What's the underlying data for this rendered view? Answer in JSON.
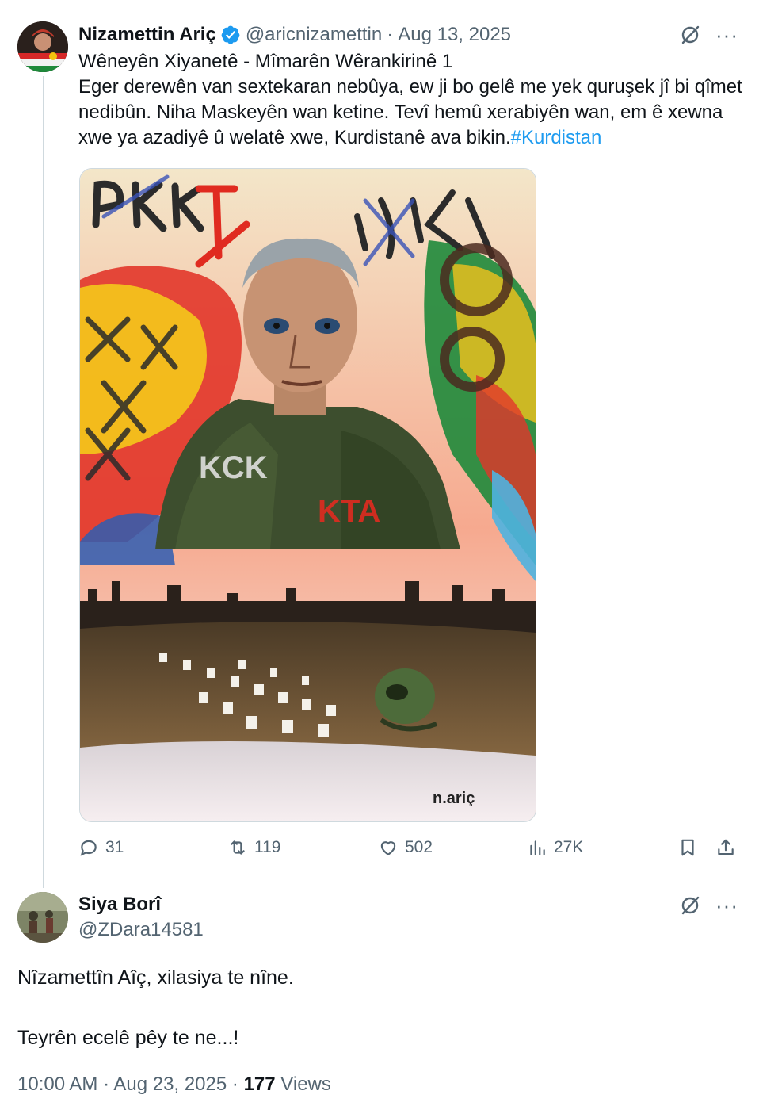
{
  "tweet": {
    "author_name": "Nizamettin Ariç",
    "handle": "@aricnizamettin",
    "separator": "·",
    "date": "Aug 13, 2025",
    "title_line": "Wêneyên Xiyanetê - Mîmarên Wêrankirinê 1",
    "body": "Eger derewên van sextekaran nebûya, ew ji bo gelê me yek quruşek jî bi qîmet nedibûn. Niha Maskeyên wan ketine. Tevî hemû xerabiyên wan, em ê xewna xwe ya azadiyê û welatê xwe, Kurdistanê ava bikin.",
    "hashtag": "#Kurdistan",
    "image_labels": {
      "graffiti_left": "PKK",
      "graffiti_right": "PKK",
      "shirt_left": "KCK",
      "shirt_right": "KTA",
      "signature": "n.ariç"
    },
    "stats": {
      "replies": "31",
      "reposts": "119",
      "likes": "502",
      "views": "27K"
    },
    "icons": {
      "verified": "verified-badge-icon",
      "grok": "grok-icon",
      "more": "more-icon",
      "reply": "reply-icon",
      "repost": "repost-icon",
      "like": "heart-icon",
      "views": "views-icon",
      "bookmark": "bookmark-icon",
      "share": "share-icon"
    },
    "accent_color": "#1d9bf0"
  },
  "reply": {
    "author_name": "Siya Borî",
    "handle": "@ZDara14581",
    "line1": "Nîzamettîn Aîç, xilasiya te nîne.",
    "line2": "Teyrên ecelê pêy te ne...!",
    "time": "10:00 AM",
    "separator": "·",
    "date": "Aug 23, 2025",
    "separator2": "·",
    "views_count": "177",
    "views_label": "Views"
  },
  "more_glyph": "···"
}
